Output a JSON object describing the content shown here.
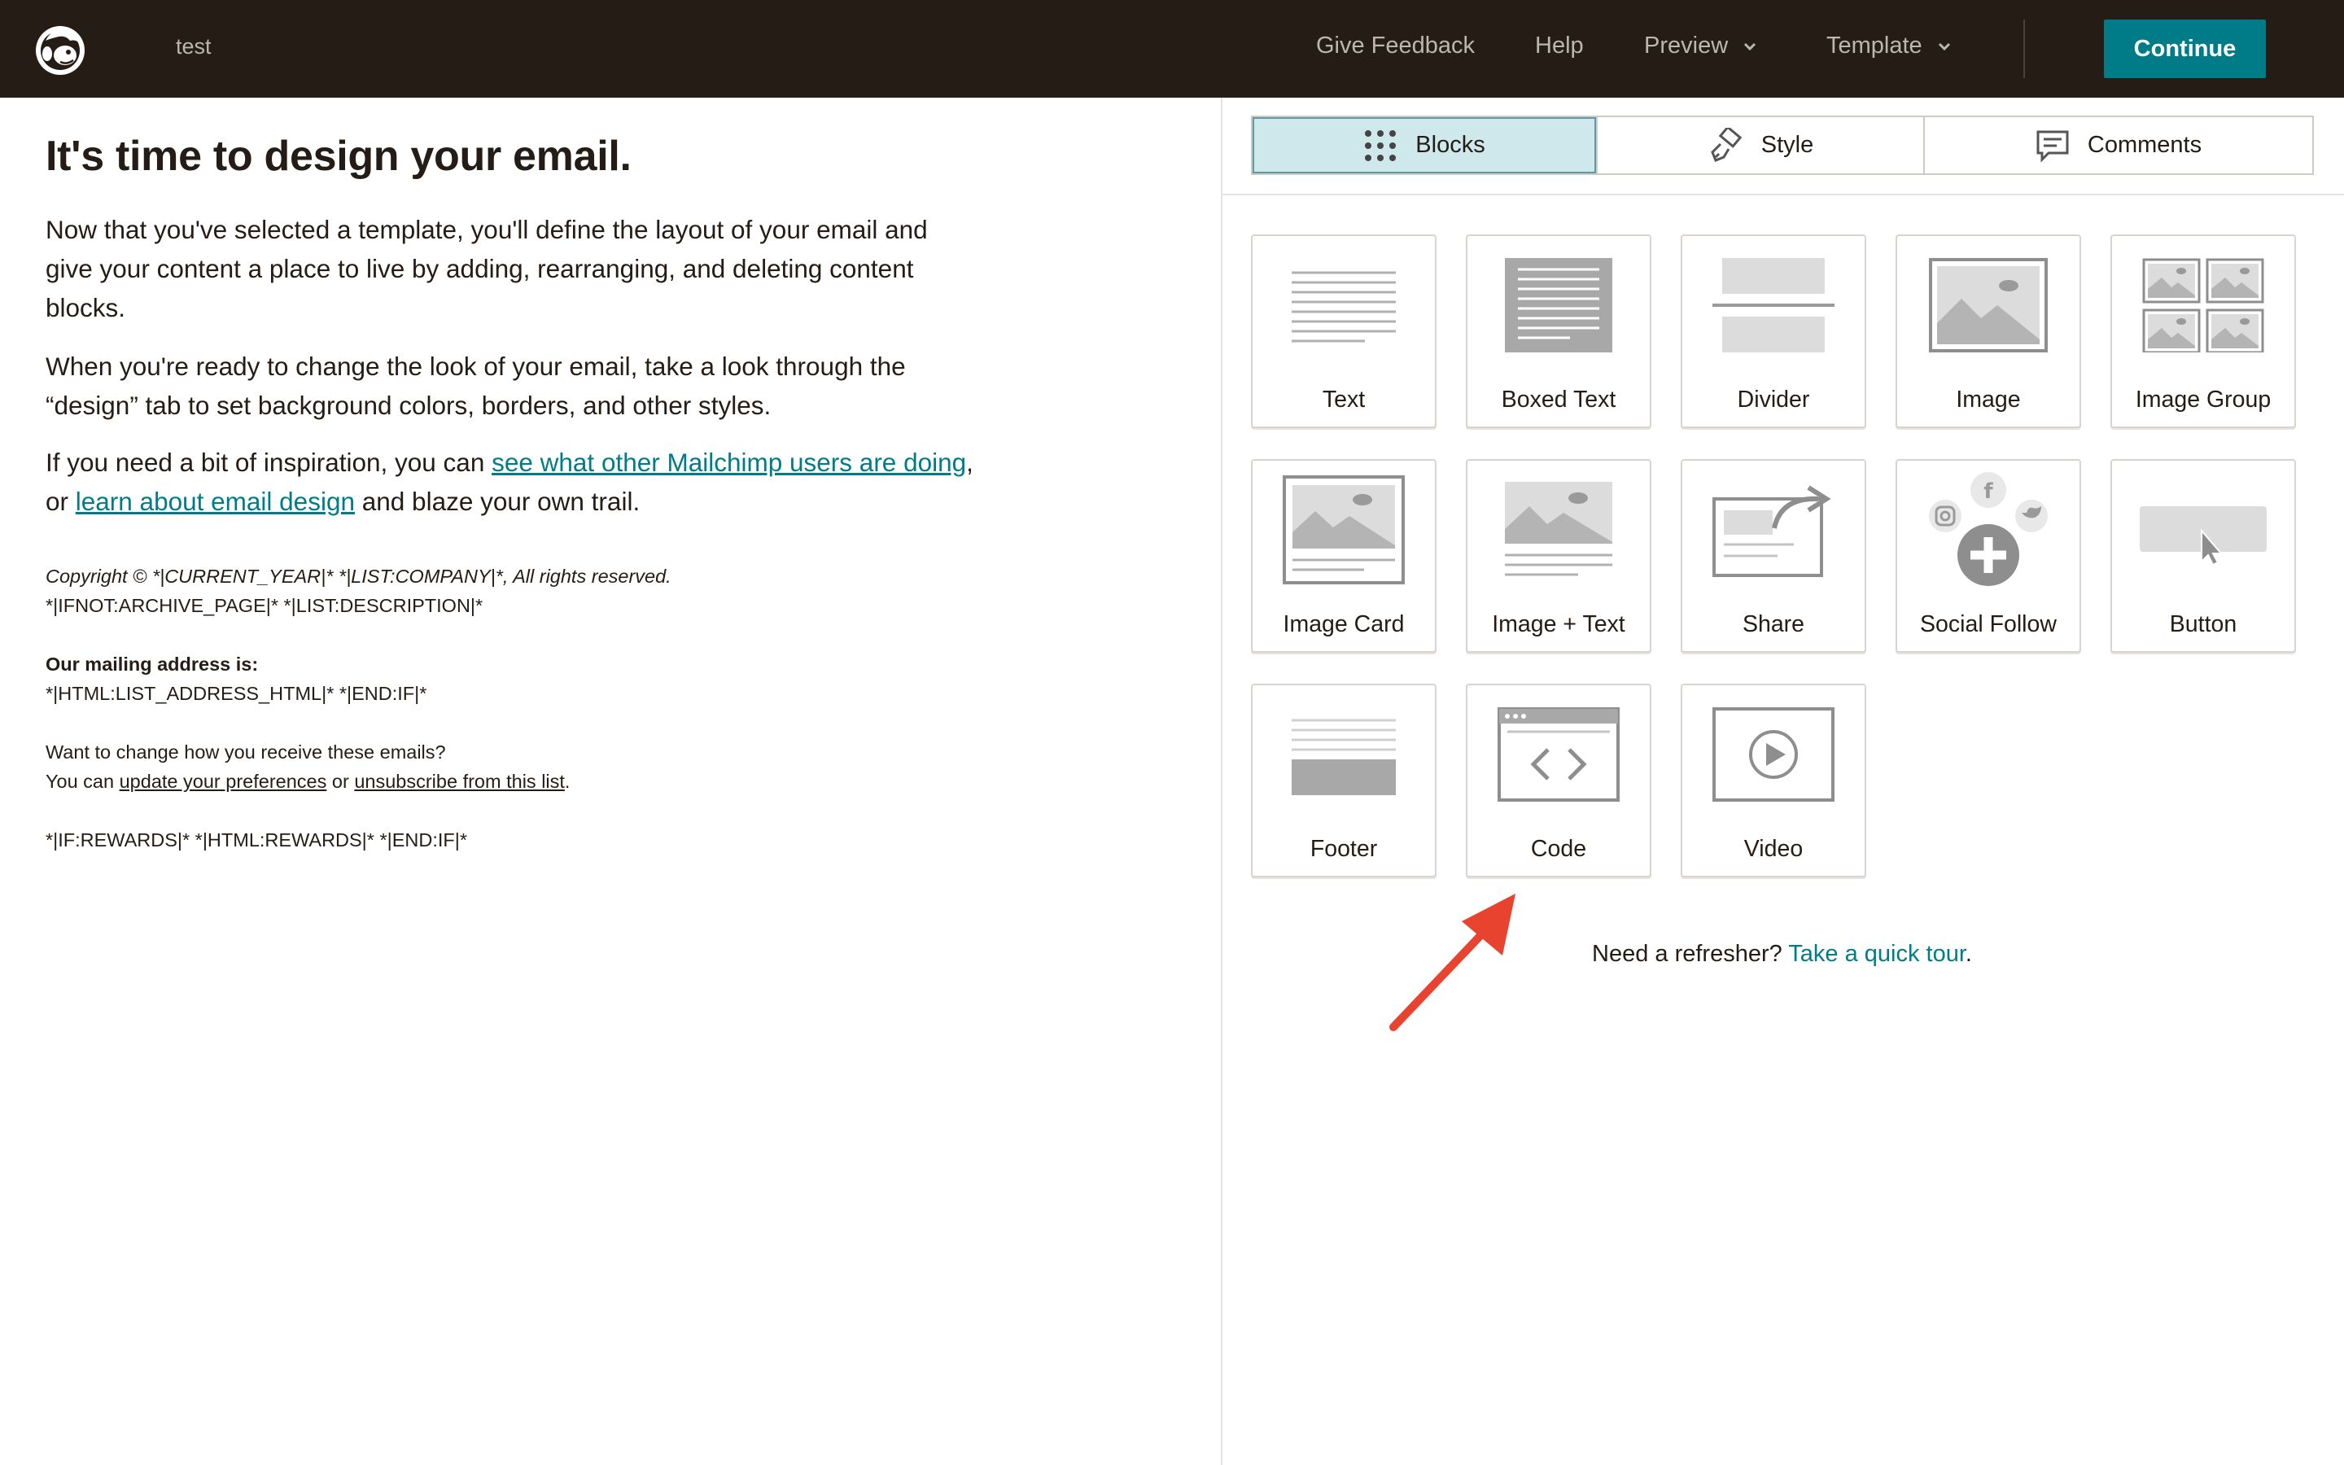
{
  "header": {
    "doc_name": "test",
    "give_feedback": "Give Feedback",
    "help": "Help",
    "preview": "Preview",
    "template": "Template",
    "continue": "Continue",
    "logo_icon": "mailchimp-freddie-logo",
    "chevron_icon": "chevron-down-icon"
  },
  "content": {
    "heading": "It's time to design your email.",
    "p1": "Now that you've selected a template, you'll define the layout of your email and give your content a place to live by adding, rearranging, and deleting content blocks.",
    "p2": "When you're ready to change the look of your email, take a look through the “design” tab to set background colors, borders, and other styles.",
    "p3_before": "If you need a bit of inspiration, you can ",
    "p3_link1": "see what other Mailchimp users are doing",
    "p3_middle": ", or ",
    "p3_link2": "learn about email design",
    "p3_after": " and blaze your own trail."
  },
  "footer_preview": {
    "copyright": "Copyright © *|CURRENT_YEAR|* *|LIST:COMPANY|*, All rights reserved.",
    "archive_line": "*|IFNOT:ARCHIVE_PAGE|* *|LIST:DESCRIPTION|*",
    "mailing_label": "Our mailing address is:",
    "address_merge": "*|HTML:LIST_ADDRESS_HTML|* *|END:IF|*",
    "change_question": "Want to change how you receive these emails?",
    "you_can": "You can ",
    "update_link": "update your preferences",
    "or_text": " or ",
    "unsubscribe_link": "unsubscribe from this list",
    "period": ".",
    "rewards": "*|IF:REWARDS|* *|HTML:REWARDS|* *|END:IF|*"
  },
  "tabs": [
    {
      "label": "Blocks",
      "icon": "grid-dots-icon",
      "active": true
    },
    {
      "label": "Style",
      "icon": "paint-brush-icon",
      "active": false
    },
    {
      "label": "Comments",
      "icon": "comment-icon",
      "active": false
    }
  ],
  "blocks": [
    {
      "label": "Text",
      "icon": "text-block-icon"
    },
    {
      "label": "Boxed Text",
      "icon": "boxed-text-icon"
    },
    {
      "label": "Divider",
      "icon": "divider-icon"
    },
    {
      "label": "Image",
      "icon": "image-icon"
    },
    {
      "label": "Image Group",
      "icon": "image-group-icon"
    },
    {
      "label": "Image Card",
      "icon": "image-card-icon"
    },
    {
      "label": "Image + Text",
      "icon": "image-text-icon"
    },
    {
      "label": "Share",
      "icon": "share-icon"
    },
    {
      "label": "Social Follow",
      "icon": "social-follow-icon"
    },
    {
      "label": "Button",
      "icon": "button-block-icon"
    },
    {
      "label": "Footer",
      "icon": "footer-icon"
    },
    {
      "label": "Code",
      "icon": "code-icon"
    },
    {
      "label": "Video",
      "icon": "video-icon"
    }
  ],
  "refresher": {
    "text": "Need a refresher? ",
    "link": "Take a quick tour",
    "period": "."
  },
  "annotation": {
    "icon": "red-arrow-pointer-icon",
    "color": "#e8432e"
  },
  "colors": {
    "topbar": "#241c15",
    "accent": "#007c89",
    "active_tab": "#cfe8ec",
    "icon_gray": "#b5b5b5"
  }
}
